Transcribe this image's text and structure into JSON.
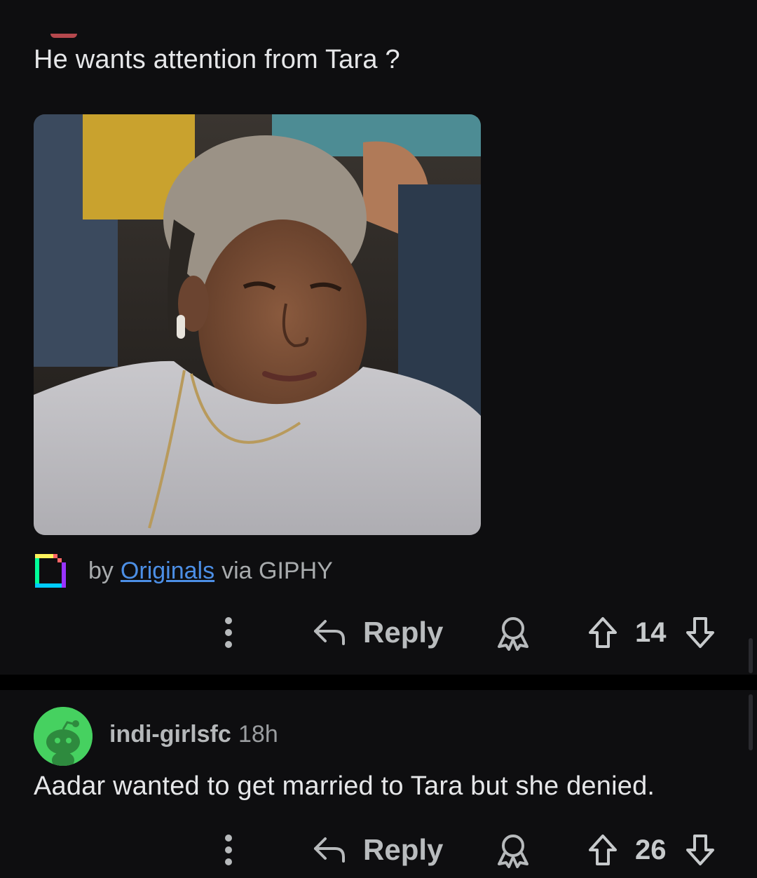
{
  "comment1": {
    "text": "He wants attention from Tara ?",
    "gif": {
      "by_label": "by",
      "source_link": "Originals",
      "via_label": "via GIPHY"
    },
    "actions": {
      "reply_label": "Reply",
      "score": "14"
    }
  },
  "comment2": {
    "username": "indi-girlsfc",
    "time": "18h",
    "text": "Aadar wanted to get married to Tara but she denied.",
    "actions": {
      "reply_label": "Reply",
      "score": "26"
    }
  },
  "colors": {
    "background": "#0e0e10",
    "link": "#4c8fe6",
    "avatar_bg": "#46d160",
    "text": "#e6e7e9",
    "muted": "#b7babc"
  },
  "icons": [
    "more-vertical-icon",
    "reply-arrow-icon",
    "award-icon",
    "upvote-icon",
    "downvote-icon",
    "giphy-logo",
    "snoo-avatar"
  ]
}
